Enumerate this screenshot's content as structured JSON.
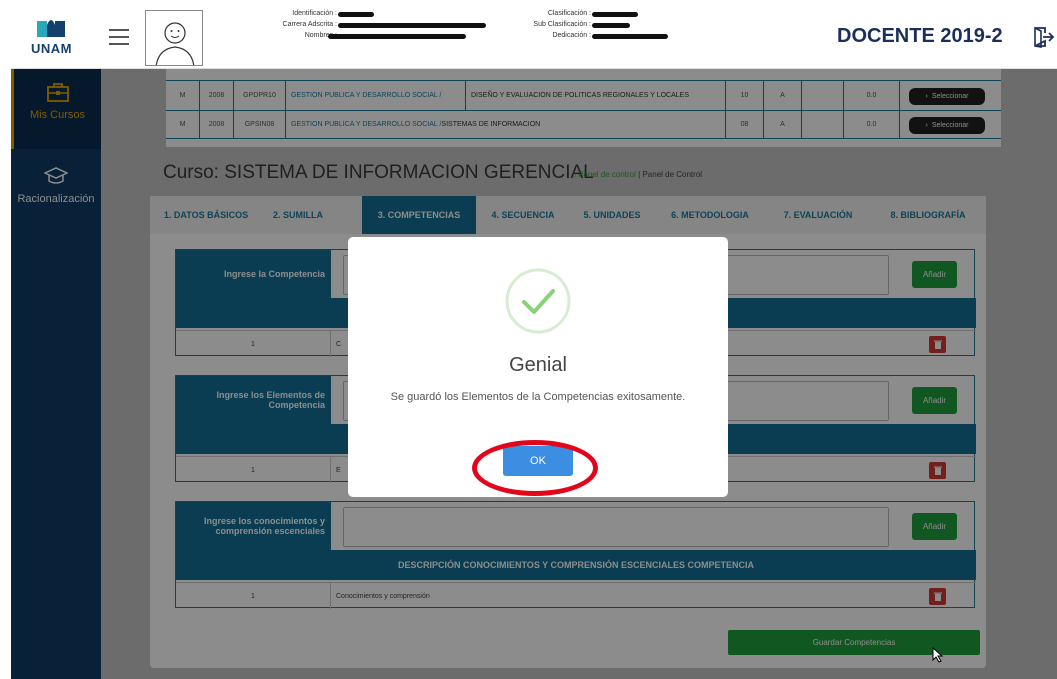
{
  "header": {
    "logo_text": "UNAM",
    "labels": {
      "identificacion": "Identificación :",
      "carrera": "Carrera Adscrita :",
      "nombres": "Nombres :",
      "clasificacion": "Clasificación :",
      "sub_clasificacion": "Sub Clasificación :",
      "dedicacion": "Dedicación :"
    },
    "role": "DOCENTE 2019-2"
  },
  "sidebar": {
    "items": [
      {
        "label": "Mis Cursos",
        "icon": "briefcase-icon",
        "active": true
      },
      {
        "label": "Racionalización",
        "icon": "graduation-cap-icon",
        "active": false
      }
    ]
  },
  "course_table": {
    "rows": [
      {
        "col1": "M",
        "year": "2008",
        "code": "GPDPR10",
        "program": "GESTION PUBLICA Y DESARROLLO SOCIAL /",
        "course": "DISEÑO Y EVALUACION DE POLITICAS REGIONALES Y LOCALES",
        "credits": "10",
        "group": "A",
        "score": "0.0",
        "action": "Seleccionar"
      },
      {
        "col1": "M",
        "year": "2008",
        "code": "GPSIN08",
        "program": "GESTION PUBLICA Y DESARROLLO SOCIAL /",
        "course": "SISTEMAS DE INFORMACION",
        "credits": "08",
        "group": "A",
        "score": "0.0",
        "action": "Seleccionar"
      }
    ]
  },
  "course": {
    "title": "Curso: SISTEMA DE INFORMACION GERENCIAL",
    "crumb_home": "Panel de control",
    "crumb_sep": "|",
    "crumb_current": "Panel de Control"
  },
  "tabs": [
    {
      "label": "1. DATOS BÁSICOS",
      "active": false
    },
    {
      "label": "2. SUMILLA",
      "active": false
    },
    {
      "label": "3. COMPETENCIAS",
      "active": true
    },
    {
      "label": "4. SECUENCIA",
      "active": false
    },
    {
      "label": "5. UNIDADES",
      "active": false
    },
    {
      "label": "6. METODOLOGIA",
      "active": false
    },
    {
      "label": "7. EVALUACIÓN",
      "active": false
    },
    {
      "label": "8. BIBLIOGRAFÍA",
      "active": false
    }
  ],
  "sections": [
    {
      "label": "Ingrese la Competencia",
      "add": "Añadir",
      "bar": "",
      "row_num": "1",
      "row_desc": "C"
    },
    {
      "label": "Ingrese los Elementos de Competencia",
      "add": "Añadir",
      "bar": "",
      "row_num": "1",
      "row_desc": "E"
    },
    {
      "label": "Ingrese los conocimientos y comprensión escenciales",
      "add": "Añadir",
      "bar": "DESCRIPCIÓN CONOCIMIENTOS Y COMPRENSIÓN ESCENCIALES COMPETENCIA",
      "row_num": "1",
      "row_desc": "Conocimientos y comprensión"
    }
  ],
  "save_button": "Guardar Competencias",
  "modal": {
    "title": "Genial",
    "message": "Se guardó los Elementos de la Competencias exitosamente.",
    "ok": "OK"
  },
  "colors": {
    "brand_blue": "#136f94",
    "sidebar": "#0f3b66",
    "success": "#1e9e3e",
    "danger": "#d23a36",
    "highlight_ring": "#e3061b"
  }
}
